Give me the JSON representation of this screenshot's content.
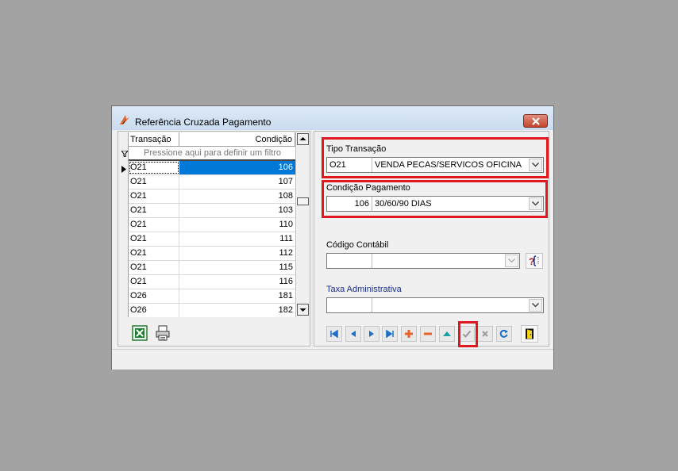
{
  "window": {
    "title": "Referência Cruzada Pagamento"
  },
  "grid": {
    "columns": [
      "Transação",
      "Condição"
    ],
    "filter_placeholder": "Pressione aqui para definir um filtro",
    "rows": [
      {
        "transacao": "O21",
        "condicao": "106",
        "selected": true
      },
      {
        "transacao": "O21",
        "condicao": "107"
      },
      {
        "transacao": "O21",
        "condicao": "108"
      },
      {
        "transacao": "O21",
        "condicao": "103"
      },
      {
        "transacao": "O21",
        "condicao": "110"
      },
      {
        "transacao": "O21",
        "condicao": "111"
      },
      {
        "transacao": "O21",
        "condicao": "112"
      },
      {
        "transacao": "O21",
        "condicao": "115"
      },
      {
        "transacao": "O21",
        "condicao": "116"
      },
      {
        "transacao": "O26",
        "condicao": "181"
      },
      {
        "transacao": "O26",
        "condicao": "182"
      }
    ]
  },
  "form": {
    "tipo_transacao": {
      "label": "Tipo Transação",
      "code": "O21",
      "description": "VENDA PECAS/SERVICOS OFICINA"
    },
    "condicao_pagamento": {
      "label": "Condição Pagamento",
      "code": "106",
      "description": "30/60/90 DIAS"
    },
    "codigo_contabil": {
      "label": "Código Contábil",
      "code": "",
      "description": ""
    },
    "taxa_administrativa": {
      "label": "Taxa Administrativa",
      "code": "",
      "description": ""
    }
  },
  "icons": {
    "excel": "excel-export-icon",
    "print": "printer-icon",
    "lookup": "lookup-icon",
    "exit": "exit-door-icon"
  },
  "colors": {
    "highlight": "#e0181e",
    "selection": "#0078d7",
    "label_blue": "#1a2c8c"
  }
}
